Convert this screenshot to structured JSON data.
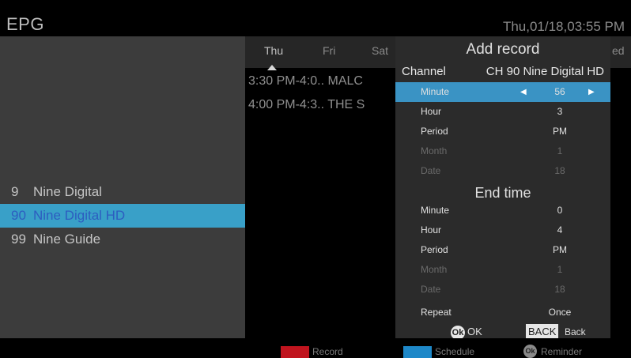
{
  "header": {
    "title": "EPG",
    "datetime": "Thu,01/18,03:55 PM"
  },
  "days": [
    "Thu",
    "Fri",
    "Sat"
  ],
  "day_overflow": "ed",
  "programmes": [
    {
      "time": "3:30 PM-4:0..",
      "title": "MALC"
    },
    {
      "time": "4:00 PM-4:3..",
      "title": "THE S"
    }
  ],
  "channels": [
    {
      "num": "9",
      "name": "Nine Digital"
    },
    {
      "num": "90",
      "name": "Nine Digital HD"
    },
    {
      "num": "99",
      "name": "Nine Guide"
    }
  ],
  "dialog": {
    "title": "Add record",
    "channel_label": "Channel",
    "channel_value": "CH 90  Nine Digital HD",
    "start_rows": [
      {
        "label": "Minute",
        "value": "56"
      },
      {
        "label": "Hour",
        "value": "3"
      },
      {
        "label": "Period",
        "value": "PM"
      },
      {
        "label": "Month",
        "value": "1"
      },
      {
        "label": "Date",
        "value": "18"
      }
    ],
    "end_title": "End time",
    "end_rows": [
      {
        "label": "Minute",
        "value": "0"
      },
      {
        "label": "Hour",
        "value": "4"
      },
      {
        "label": "Period",
        "value": "PM"
      },
      {
        "label": "Month",
        "value": "1"
      },
      {
        "label": "Date",
        "value": "18"
      }
    ],
    "repeat_label": "Repeat",
    "repeat_value": "Once",
    "ok_icon": "Ok",
    "ok_label": "OK",
    "back_icon": "BACK",
    "back_label": "Back"
  },
  "footer": {
    "record": "Record",
    "schedule": "Schedule",
    "reminder_icon": "Ok",
    "reminder": "Reminder",
    "colors": {
      "record": "#c0141e",
      "schedule": "#1e88c8",
      "selection": "#3a93c4"
    }
  }
}
